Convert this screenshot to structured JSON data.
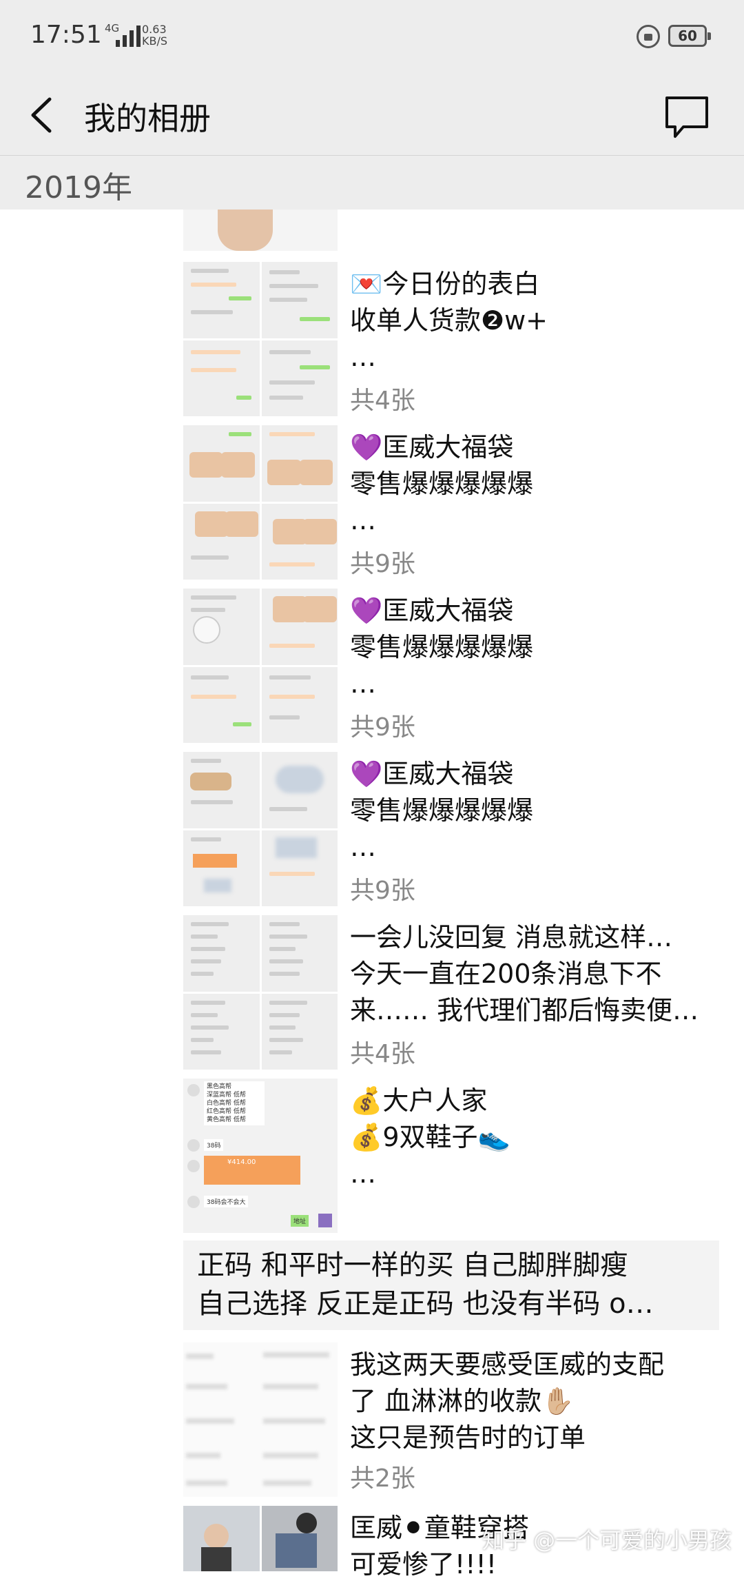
{
  "status": {
    "time": "17:51",
    "network": "4G",
    "speed_value": "0.63",
    "speed_unit": "KB/S",
    "battery": "60"
  },
  "header": {
    "title": "我的相册"
  },
  "year_label": "2019年",
  "posts": [
    {
      "text": "💌今日份的表白\n收单人货款❷w+\n…",
      "count": "共4张"
    },
    {
      "text": "💜匡威大福袋\n零售爆爆爆爆爆\n …",
      "count": "共9张"
    },
    {
      "text": "💜匡威大福袋\n零售爆爆爆爆爆\n …",
      "count": "共9张"
    },
    {
      "text": "💜匡威大福袋\n零售爆爆爆爆爆\n …",
      "count": "共9张"
    },
    {
      "text": "一会儿没回复 消息就这样…\n今天一直在200条消息下不\n来…… 我代理们都后悔卖便…",
      "count": "共4张"
    },
    {
      "text": "💰大户人家\n💰9双鞋子👟\n…",
      "count": ""
    },
    {
      "text": "我这两天要感受匡威的支配\n了 血淋淋的收款✋🏼\n这只是预告时的订单",
      "count": "共2张"
    },
    {
      "text": "匡威⚫童鞋穿搭\n可爱惨了!!!!",
      "count": ""
    }
  ],
  "text_post": "正码 和平时一样的买 自己脚胖脚瘦\n自己选择 反正是正码 也没有半码 o…",
  "chat_snippet": {
    "lines": [
      "黑色高帮",
      "深蓝高帮 低帮",
      "白色高帮 低帮",
      "红色高帮 低帮",
      "黄色高帮 低帮"
    ],
    "size1": "38码",
    "amount": "¥414.00",
    "size2": "38码会不会大",
    "address_btn": "地址"
  },
  "watermark": "知乎 @一个可爱的小男孩",
  "colors": {
    "bar_bg": "#ededed",
    "count_gray": "#888888",
    "wechat_green": "#9be07a",
    "transfer_orange": "#f5a05a"
  }
}
